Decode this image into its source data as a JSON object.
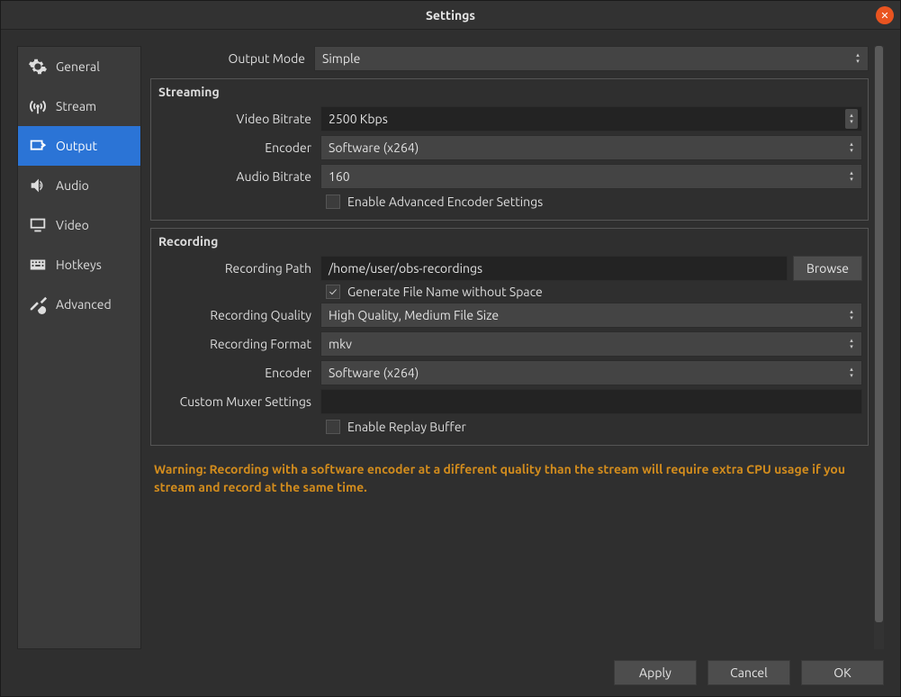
{
  "window": {
    "title": "Settings"
  },
  "sidebar": {
    "items": [
      {
        "label": "General"
      },
      {
        "label": "Stream"
      },
      {
        "label": "Output"
      },
      {
        "label": "Audio"
      },
      {
        "label": "Video"
      },
      {
        "label": "Hotkeys"
      },
      {
        "label": "Advanced"
      }
    ]
  },
  "output_mode": {
    "label": "Output Mode",
    "value": "Simple"
  },
  "streaming": {
    "title": "Streaming",
    "video_bitrate_label": "Video Bitrate",
    "video_bitrate_value": "2500 Kbps",
    "encoder_label": "Encoder",
    "encoder_value": "Software (x264)",
    "audio_bitrate_label": "Audio Bitrate",
    "audio_bitrate_value": "160",
    "advanced_checkbox_label": "Enable Advanced Encoder Settings"
  },
  "recording": {
    "title": "Recording",
    "path_label": "Recording Path",
    "path_value": "/home/user/obs-recordings",
    "browse_label": "Browse",
    "gen_filename_label": "Generate File Name without Space",
    "quality_label": "Recording Quality",
    "quality_value": "High Quality, Medium File Size",
    "format_label": "Recording Format",
    "format_value": "mkv",
    "encoder_label": "Encoder",
    "encoder_value": "Software (x264)",
    "muxer_label": "Custom Muxer Settings",
    "muxer_value": "",
    "replay_buffer_label": "Enable Replay Buffer"
  },
  "warning_text": "Warning: Recording with a software encoder at a different quality than the stream will require extra CPU usage if you stream and record at the same time.",
  "footer": {
    "apply": "Apply",
    "cancel": "Cancel",
    "ok": "OK"
  }
}
